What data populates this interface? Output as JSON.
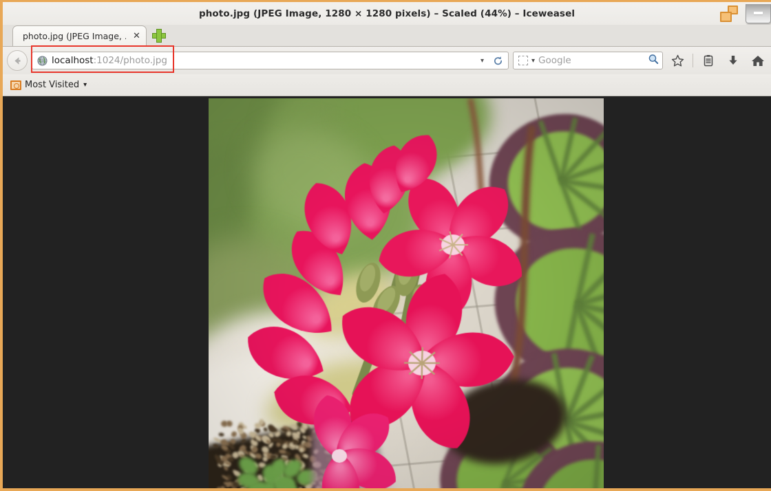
{
  "window": {
    "title": "photo.jpg (JPEG Image, 1280 × 1280 pixels) – Scaled (44%) – Iceweasel",
    "restore_icon": "window-stack-icon",
    "minimize_icon": "minimize-icon",
    "border_color": "#e8a857"
  },
  "tabs": {
    "active": {
      "label": "photo.jpg (JPEG Image, ...",
      "close_icon": "close-icon"
    },
    "new_tab_icon": "plus-icon"
  },
  "navbar": {
    "back_icon": "back-arrow-icon",
    "favicon": "globe-icon",
    "url_host": "localhost",
    "url_rest": ":1024/photo.jpg",
    "url_full": "localhost:1024/photo.jpg",
    "url_dropdown_icon": "chevron-down-icon",
    "reload_icon": "reload-icon",
    "search": {
      "engine": "Google",
      "placeholder": "Google",
      "value": "",
      "engine_icon": "search-engine-icon",
      "engine_chevron_icon": "chevron-down-icon",
      "go_icon": "magnifier-icon"
    },
    "tools": [
      {
        "name": "bookmark-star-icon",
        "label": "Bookmark"
      },
      {
        "name": "reading-list-icon",
        "label": "Reading List"
      },
      {
        "name": "downloads-icon",
        "label": "Downloads"
      },
      {
        "name": "home-icon",
        "label": "Home"
      }
    ]
  },
  "bookmarks": {
    "items": [
      {
        "label": "Most Visited",
        "icon": "most-visited-icon",
        "chevron": "chevron-down-icon"
      }
    ]
  },
  "content": {
    "background_color": "#222222",
    "image": {
      "name": "photo.jpg",
      "alt": "Close-up photograph of bright pink geranium flowers with green leaves over pale tiled floor",
      "natural_width": 1280,
      "natural_height": 1280,
      "scale_percent": 44,
      "displayed_width": 574,
      "displayed_height": 574
    }
  },
  "annotation": {
    "highlight_color": "#e8362b",
    "target": "url-bar"
  }
}
